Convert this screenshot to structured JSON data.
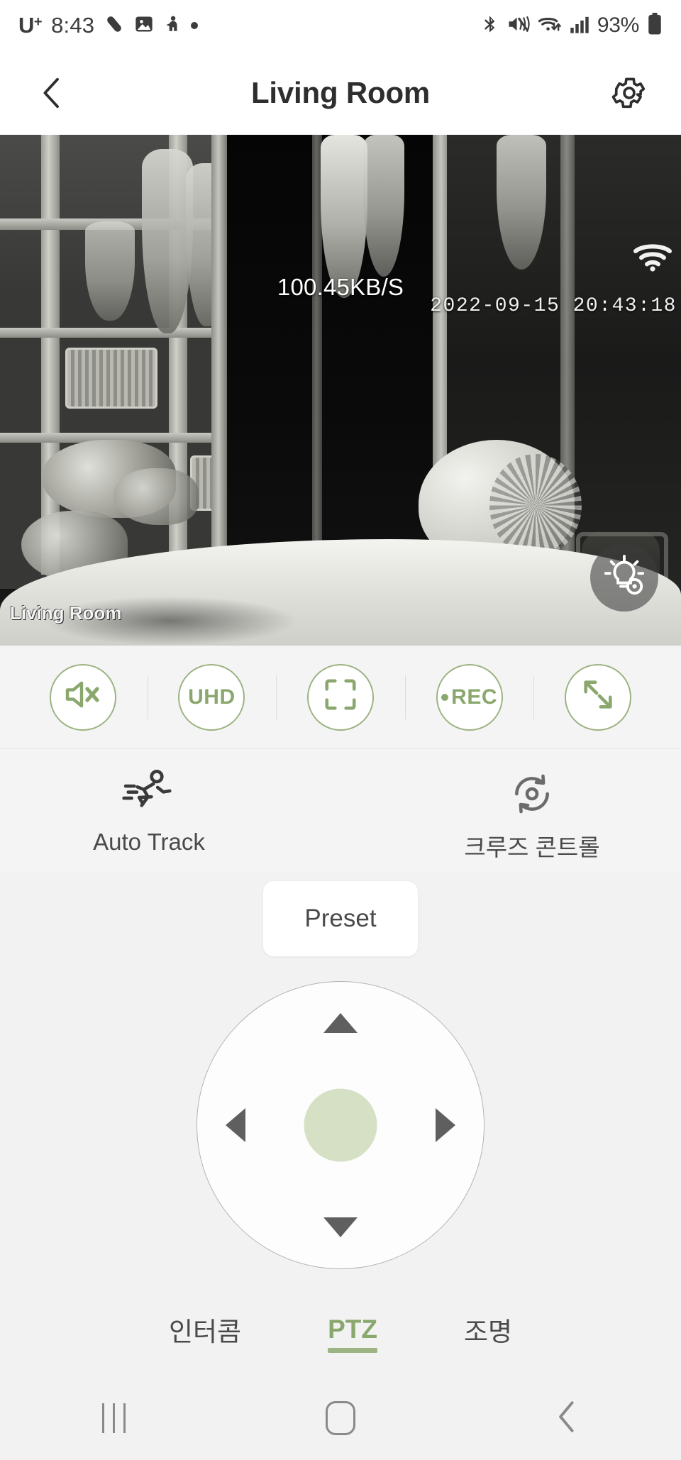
{
  "status_bar": {
    "carrier": "U",
    "carrier_sup": "+",
    "time": "8:43",
    "battery_percent": "93%",
    "left_icons": [
      "pill-icon",
      "image-icon",
      "person-icon",
      "dot-icon"
    ],
    "right_icons": [
      "bluetooth-icon",
      "mute-icon",
      "wifi-transfer-icon",
      "signal-bars-icon",
      "battery-icon"
    ]
  },
  "header": {
    "back_label": "Back",
    "title": "Living Room",
    "settings_label": "Settings"
  },
  "video": {
    "bitrate": "100.45KB/S",
    "timestamp": "2022-09-15  20:43:18",
    "camera_label": "Living Room",
    "wifi_icon": "wifi-icon",
    "light_button_label": "Light settings"
  },
  "controls": {
    "accent": "#8aa86e",
    "border": "#9cb382",
    "buttons": [
      {
        "name": "mute-button",
        "label": "",
        "icon": "speaker-mute-icon"
      },
      {
        "name": "quality-button",
        "label": "UHD",
        "icon": "uhd-text-icon"
      },
      {
        "name": "snapshot-button",
        "label": "",
        "icon": "capture-frame-icon"
      },
      {
        "name": "record-button",
        "label": "REC",
        "icon": "record-dot-icon"
      },
      {
        "name": "fullscreen-button",
        "label": "",
        "icon": "expand-arrows-icon"
      }
    ]
  },
  "features": [
    {
      "name": "auto-track",
      "label": "Auto Track",
      "icon": "running-person-icon"
    },
    {
      "name": "cruise-control",
      "label": "크루즈 콘트롤",
      "icon": "cruise-rotate-icon"
    }
  ],
  "preset": {
    "label": "Preset"
  },
  "dpad": {
    "center_color": "#d6e0c5",
    "up_label": "Tilt up",
    "down_label": "Tilt down",
    "left_label": "Pan left",
    "right_label": "Pan right",
    "center_label": "Home position"
  },
  "tabs": [
    {
      "name": "tab-intercom",
      "label": "인터콤",
      "active": false
    },
    {
      "name": "tab-ptz",
      "label": "PTZ",
      "active": true
    },
    {
      "name": "tab-lighting",
      "label": "조명",
      "active": false
    }
  ],
  "navbar": {
    "recents_label": "Recents",
    "home_label": "Home",
    "back_label": "Back"
  }
}
